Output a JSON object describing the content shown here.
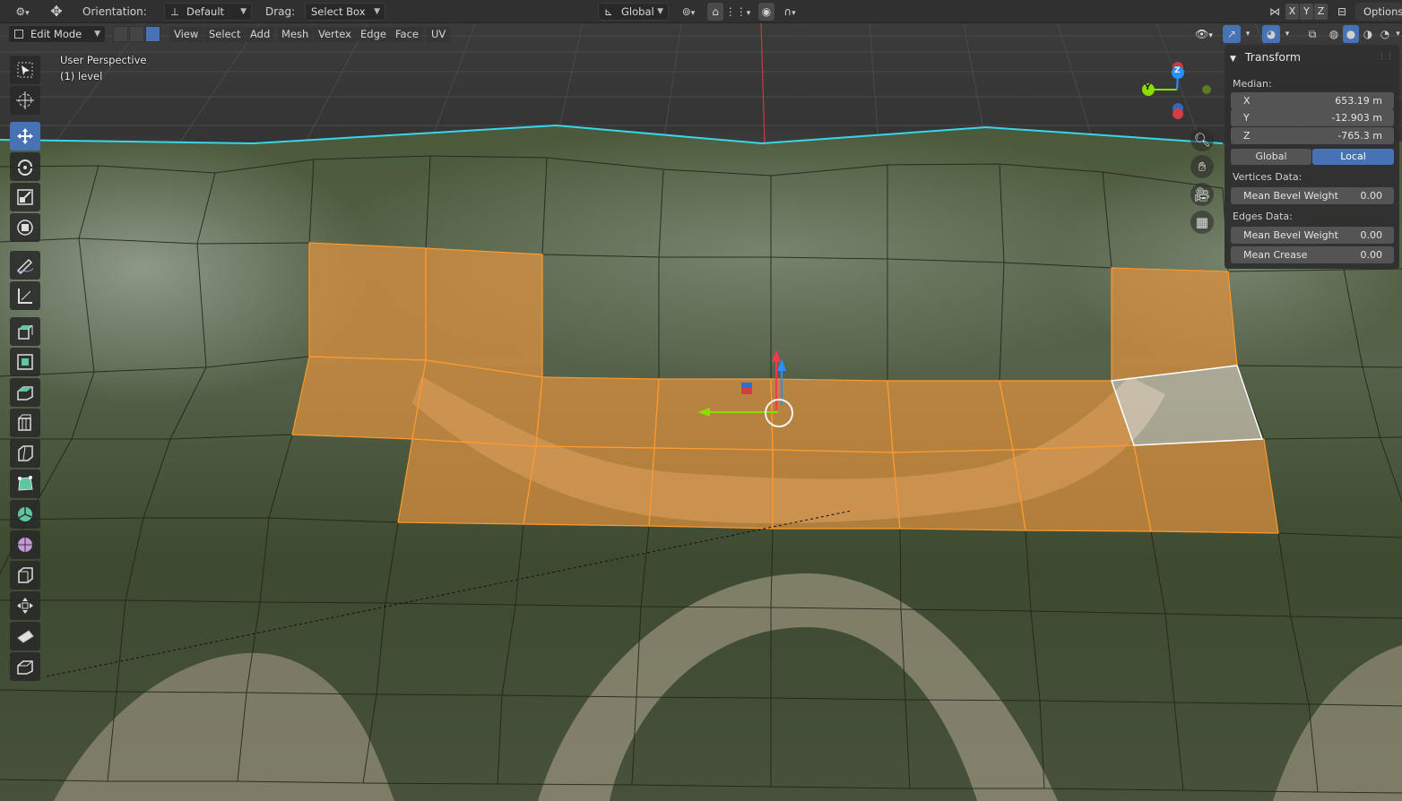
{
  "topbar": {
    "orientation_label": "Orientation:",
    "orientation_value": "Default",
    "drag_label": "Drag:",
    "drag_value": "Select Box",
    "transform_space": "Global",
    "axes": [
      "X",
      "Y",
      "Z"
    ],
    "options_label": "Options"
  },
  "header": {
    "mode": "Edit Mode",
    "menus": [
      "View",
      "Select",
      "Add",
      "Mesh",
      "Vertex",
      "Edge",
      "Face",
      "UV"
    ]
  },
  "viewport": {
    "view_name": "User Perspective",
    "object_label": "(1) level"
  },
  "gizmo": {
    "y_label": "Y",
    "z_label": "Z"
  },
  "npanel": {
    "title": "Transform",
    "median_label": "Median:",
    "median": [
      {
        "axis": "X",
        "value": "653.19 m"
      },
      {
        "axis": "Y",
        "value": "-12.903 m"
      },
      {
        "axis": "Z",
        "value": "-765.3 m"
      }
    ],
    "global_label": "Global",
    "local_label": "Local",
    "active_space": "Local",
    "vertices_data_label": "Vertices Data:",
    "vertex_mean_bevel_label": "Mean Bevel Weight",
    "vertex_mean_bevel_value": "0.00",
    "edges_data_label": "Edges Data:",
    "edge_mean_bevel_label": "Mean Bevel Weight",
    "edge_mean_bevel_value": "0.00",
    "mean_crease_label": "Mean Crease",
    "mean_crease_value": "0.00"
  },
  "colors": {
    "selection_face": "#e8953f",
    "selection_edge": "#ff9a2e",
    "active_face": "#ffffff",
    "active_button": "#4772b3",
    "horizon_edge": "#3ad5e8",
    "axis_x": "#ff3352",
    "axis_y": "#8bdc00",
    "axis_z": "#2890ff"
  }
}
